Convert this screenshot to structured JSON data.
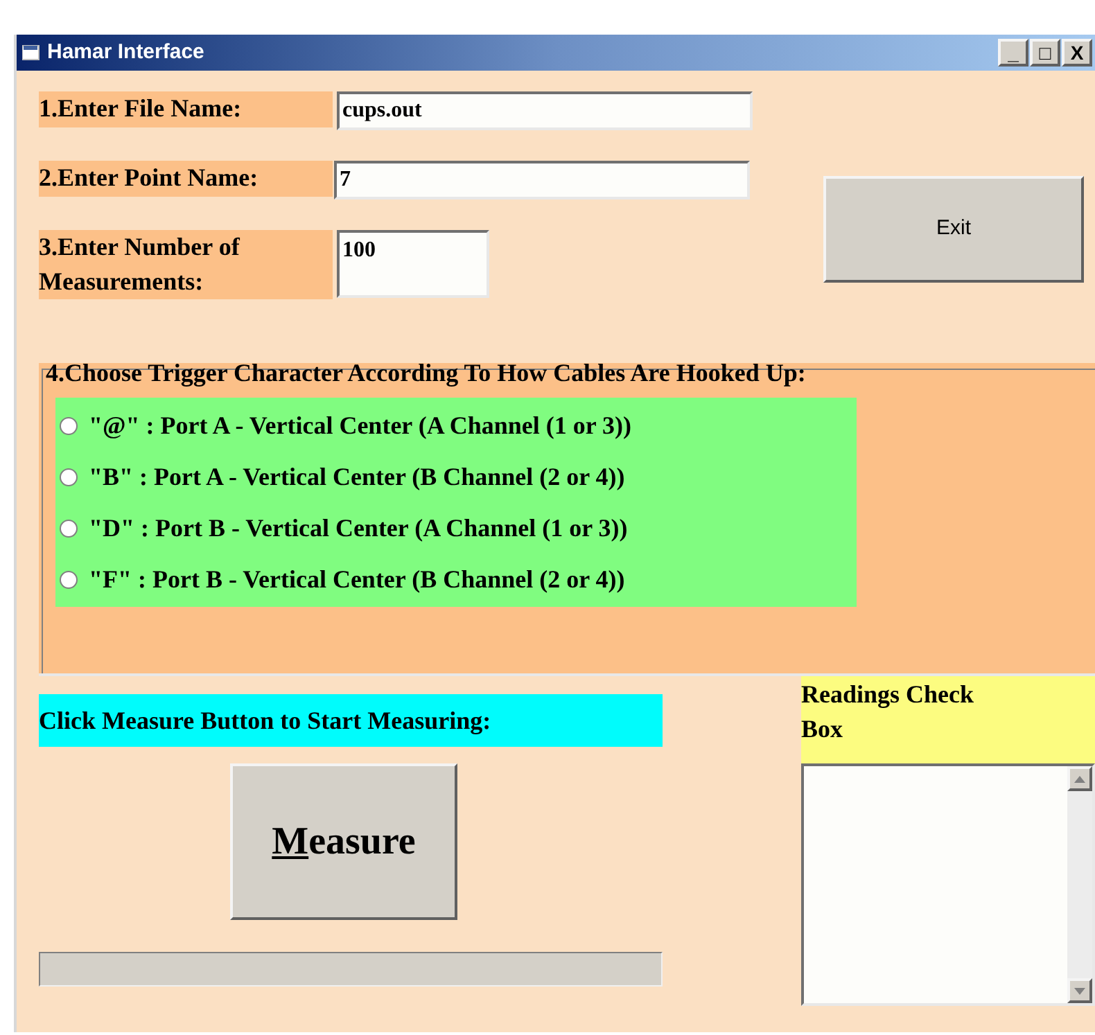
{
  "window": {
    "title": "Hamar Interface",
    "controls": [
      "_",
      "□",
      "X"
    ]
  },
  "fields": [
    {
      "label": "1.Enter File Name:",
      "value": "cups.out"
    },
    {
      "label": "2.Enter Point Name:",
      "value": "7"
    },
    {
      "label": "3.Enter Number of Measurements:",
      "value": "100"
    }
  ],
  "exit_button": {
    "label": "Exit"
  },
  "trigger_group": {
    "title": "4.Choose Trigger Character According To How Cables Are Hooked Up:",
    "options": [
      {
        "label": "\"@\" : Port A - Vertical Center (A Channel (1 or 3))",
        "selected": false
      },
      {
        "label": "\"B\" : Port A - Vertical Center (B Channel (2 or 4))",
        "selected": false
      },
      {
        "label": "\"D\" : Port B - Vertical Center (A Channel (1 or 3))",
        "selected": false
      },
      {
        "label": "\"F\" : Port B - Vertical Center (B Channel (2 or 4))",
        "selected": false
      }
    ]
  },
  "measure": {
    "instruction": "Click Measure Button to Start Measuring:",
    "button": "Measure",
    "first_letter_underlined": true
  },
  "readings": {
    "label": "Readings Check Box"
  }
}
